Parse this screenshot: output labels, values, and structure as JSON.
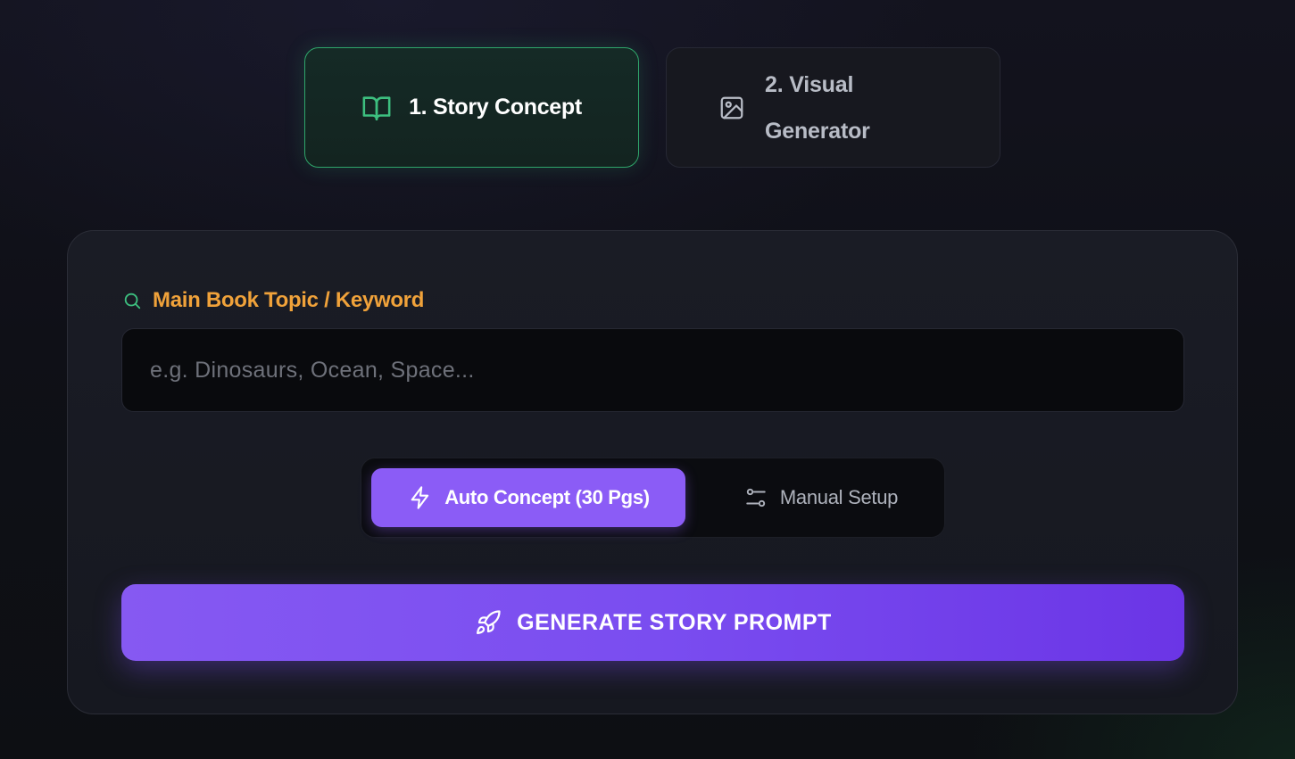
{
  "steps": [
    {
      "label": "1. Story Concept",
      "icon": "book-open-icon",
      "active": true
    },
    {
      "label": "2. Visual Generator",
      "icon": "image-icon",
      "active": false
    }
  ],
  "form": {
    "topic_label": "Main Book Topic / Keyword",
    "topic_icon": "search-icon",
    "topic_value": "",
    "topic_placeholder": "e.g. Dinosaurs, Ocean, Space..."
  },
  "mode": {
    "auto_label": "Auto Concept (30 Pgs)",
    "auto_icon": "lightning-icon",
    "manual_label": "Manual Setup",
    "manual_icon": "sliders-icon",
    "selected": "auto"
  },
  "generate": {
    "label": "GENERATE STORY PROMPT",
    "icon": "rocket-icon"
  },
  "colors": {
    "accent_green": "#2fa66b",
    "accent_orange": "#f0a23a",
    "accent_purple": "#8b5cf6"
  }
}
